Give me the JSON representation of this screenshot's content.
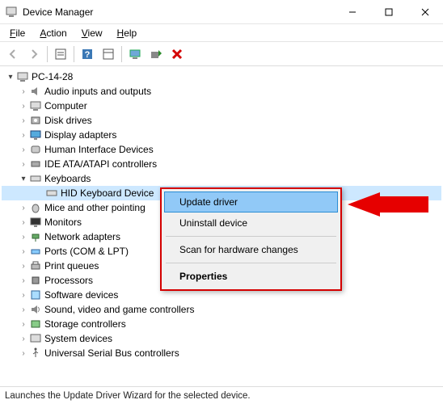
{
  "window": {
    "title": "Device Manager"
  },
  "menubar": {
    "file": "File",
    "action": "Action",
    "view": "View",
    "help": "Help"
  },
  "tree": {
    "root": "PC-14-28",
    "items": [
      {
        "label": "Audio inputs and outputs",
        "icon": "speaker"
      },
      {
        "label": "Computer",
        "icon": "computer"
      },
      {
        "label": "Disk drives",
        "icon": "disk"
      },
      {
        "label": "Display adapters",
        "icon": "display"
      },
      {
        "label": "Human Interface Devices",
        "icon": "hid"
      },
      {
        "label": "IDE ATA/ATAPI controllers",
        "icon": "ide"
      },
      {
        "label": "Keyboards",
        "icon": "keyboard",
        "expanded": true,
        "children": [
          {
            "label": "HID Keyboard Device",
            "icon": "keyboard",
            "selected": true
          }
        ]
      },
      {
        "label": "Mice and other pointing",
        "icon": "mouse"
      },
      {
        "label": "Monitors",
        "icon": "monitor"
      },
      {
        "label": "Network adapters",
        "icon": "network"
      },
      {
        "label": "Ports (COM & LPT)",
        "icon": "port"
      },
      {
        "label": "Print queues",
        "icon": "printer"
      },
      {
        "label": "Processors",
        "icon": "cpu"
      },
      {
        "label": "Software devices",
        "icon": "software"
      },
      {
        "label": "Sound, video and game controllers",
        "icon": "sound"
      },
      {
        "label": "Storage controllers",
        "icon": "storage"
      },
      {
        "label": "System devices",
        "icon": "system"
      },
      {
        "label": "Universal Serial Bus controllers",
        "icon": "usb"
      }
    ]
  },
  "context_menu": {
    "update": "Update driver",
    "uninstall": "Uninstall device",
    "scan": "Scan for hardware changes",
    "properties": "Properties"
  },
  "statusbar": {
    "text": "Launches the Update Driver Wizard for the selected device."
  }
}
